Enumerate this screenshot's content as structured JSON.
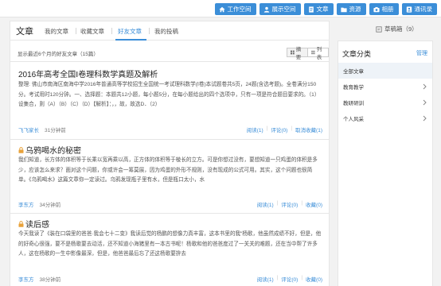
{
  "topbar": {
    "buttons": [
      {
        "label": "工作空间",
        "icon": "home-icon"
      },
      {
        "label": "展示空间",
        "icon": "user-icon"
      },
      {
        "label": "文章",
        "icon": "document-icon"
      },
      {
        "label": "资源",
        "icon": "folder-icon"
      },
      {
        "label": "相册",
        "icon": "camera-icon"
      },
      {
        "label": "通讯录",
        "icon": "contacts-icon"
      }
    ]
  },
  "header": {
    "title": "文章",
    "tabs": [
      "我的文章",
      "收藏文章",
      "好友文章",
      "我的投稿"
    ],
    "active_tab": "好友文章",
    "draft_label": "草稿箱（9）"
  },
  "list_meta": {
    "summary": "显示最近6个月的好友文章（15篇）",
    "view_summary": "摘要",
    "view_list": "列表"
  },
  "articles": [
    {
      "title": "2016年高考全国Ⅰ卷理科数学真题及解析",
      "locked": false,
      "body": "整理: 佛山市南海区南海中学2016年普通高等学校招生全国统一考试理科数学(Ⅰ卷)本试题卷共5页，24题(含选考题)。全卷满分150分。考试用时120分钟。一、选择题：本题共12小题，每小题5分，在每小题给出的四个选项中，只有一项是符合题目要求的。（1）设集合，则（A）（B）（C）（D）【解析】：，，故，故选D．（2）",
      "author": "飞飞家长",
      "time": "31分钟前",
      "reads": "阅读(1)",
      "comments": "评论(0)",
      "favorite": "取消收藏(1)"
    },
    {
      "title": "乌鸦喝水的秘密",
      "locked": true,
      "body": "我们知道，长方体的体积等于长乘以宽再乘以高，正方体的体积等于棱长的立方。可是你想过没有，要想知道一只鸡蛋的体积是多少，应该怎么来求？面对这个问题，你或许会一筹莫展，因为鸡蛋的外形不规则，没有现成的公式可用。其实，这个问题也很简单。《乌鸦喝水》这篇文章你一定读过。乌鸦发现瓶子里有水，但是瓶口太小，水",
      "author": "李东方",
      "time": "34分钟前",
      "reads": "阅读(1)",
      "comments": "评论(0)",
      "favorite": "收藏(0)"
    },
    {
      "title": "读后感",
      "locked": true,
      "body": "今天我读了《装在口袋里的爸爸·我会七十二变》我读后觉的杨鹏的想像力真丰富，这本书里的我“杨歌，他虽然成绩不好，但是，他的好奇心很强，要不是杨歌要去动活，还不知道小海猪里有一本古书呢！杨歌和他的爸爸度过了一关关的难题，还在当中帮了许多人，这在杨歌的一生中影像最深，但是，他爸爸最后忘了还这杨歌要拚去",
      "author": "李东方",
      "time": "38分钟前",
      "reads": "阅读(1)",
      "comments": "评论(0)",
      "favorite": "收藏(0)"
    }
  ],
  "sidebar": {
    "title": "文章分类",
    "manage": "管理",
    "items": [
      {
        "label": "全部文章",
        "selected": true,
        "chevron": false
      },
      {
        "label": "教育教学",
        "selected": false,
        "chevron": true
      },
      {
        "label": "教研研训",
        "selected": false,
        "chevron": true
      },
      {
        "label": "个人风采",
        "selected": false,
        "chevron": true
      }
    ]
  },
  "colors": {
    "accent": "#3b8ed8",
    "lock": "#e8a23a",
    "selected_bg": "#eef3f8"
  }
}
